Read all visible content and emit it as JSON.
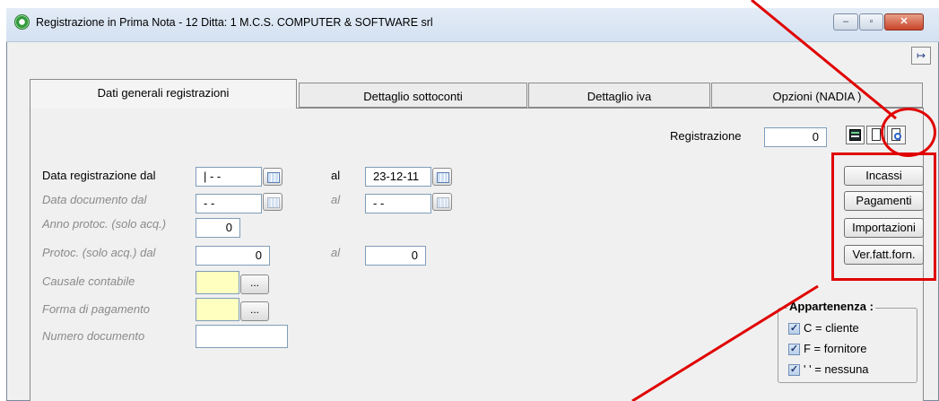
{
  "window": {
    "title": "Registrazione in Prima Nota - 12    Ditta: 1  M.C.S. COMPUTER & SOFTWARE srl",
    "buttons": {
      "minimize": "–",
      "maximize": "▫",
      "close": "✕"
    }
  },
  "toolbar": {
    "exit_icon": "exit-door-icon",
    "exit_label": "↦"
  },
  "tabs": [
    {
      "label": "Dati generali registrazioni"
    },
    {
      "label": "Dettaglio sottoconti"
    },
    {
      "label": "Dettaglio iva"
    },
    {
      "label": "Opzioni (NADIA    )"
    }
  ],
  "registrazione": {
    "label": "Registrazione",
    "value": "0"
  },
  "form": {
    "data_reg_label": "Data registrazione  dal",
    "data_reg_from": "|  - -",
    "data_reg_al_label": "al",
    "data_reg_to": "23-12-11",
    "data_doc_label": "Data documento   dal",
    "data_doc_from": " - -",
    "data_doc_al_label": "al",
    "data_doc_to": " - -",
    "anno_label": "Anno protoc. (solo acq.)",
    "anno_value": "0",
    "protoc_label": "Protoc. (solo acq.)  dal",
    "protoc_from": "0",
    "protoc_al_label": "al",
    "protoc_to": "0",
    "causale_label": "Causale contabile",
    "causale_value": "",
    "forma_label": "Forma di pagamento",
    "forma_value": "",
    "numero_label": "Numero documento",
    "numero_value": "",
    "dots_label": "..."
  },
  "side_buttons": [
    "Incassi",
    "Pagamenti",
    "Importazioni",
    "Ver.fatt.forn."
  ],
  "appartenenza": {
    "title": "Appartenenza :",
    "items": [
      {
        "label": "C = cliente",
        "checked": true
      },
      {
        "label": "F = fornitore",
        "checked": true
      },
      {
        "label": "' ' = nessuna",
        "checked": true
      }
    ],
    "check_mark": "✓"
  },
  "colors": {
    "annotation": "#e00000",
    "yellow_field": "#ffffc0",
    "title_bar": "#d4e1f1"
  }
}
